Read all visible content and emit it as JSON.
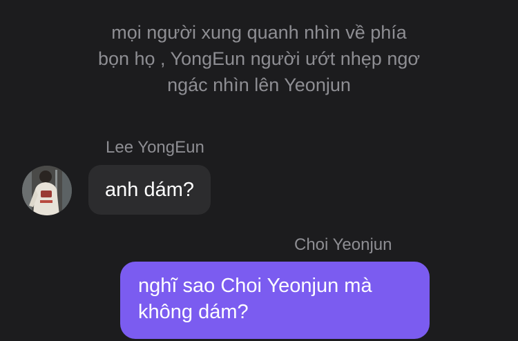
{
  "narration": {
    "lines": [
      "mọi người xung quanh nhìn về phía",
      "bọn họ , YongEun người ướt nhẹp ngơ",
      "ngác nhìn lên Yeonjun"
    ]
  },
  "messages": [
    {
      "sender": "Lee YongEun",
      "side": "left",
      "has_avatar": true,
      "text": "anh dám?"
    },
    {
      "sender": "Choi Yeonjun",
      "side": "right",
      "text_lines": [
        "nghĩ sao Choi Yeonjun mà",
        "không dám?"
      ]
    }
  ],
  "colors": {
    "background": "#1c1c1e",
    "muted_text": "#8e8e93",
    "incoming_bubble": "#2c2c2e",
    "outgoing_bubble": "#7b5cf0",
    "bubble_text": "#ffffff"
  }
}
